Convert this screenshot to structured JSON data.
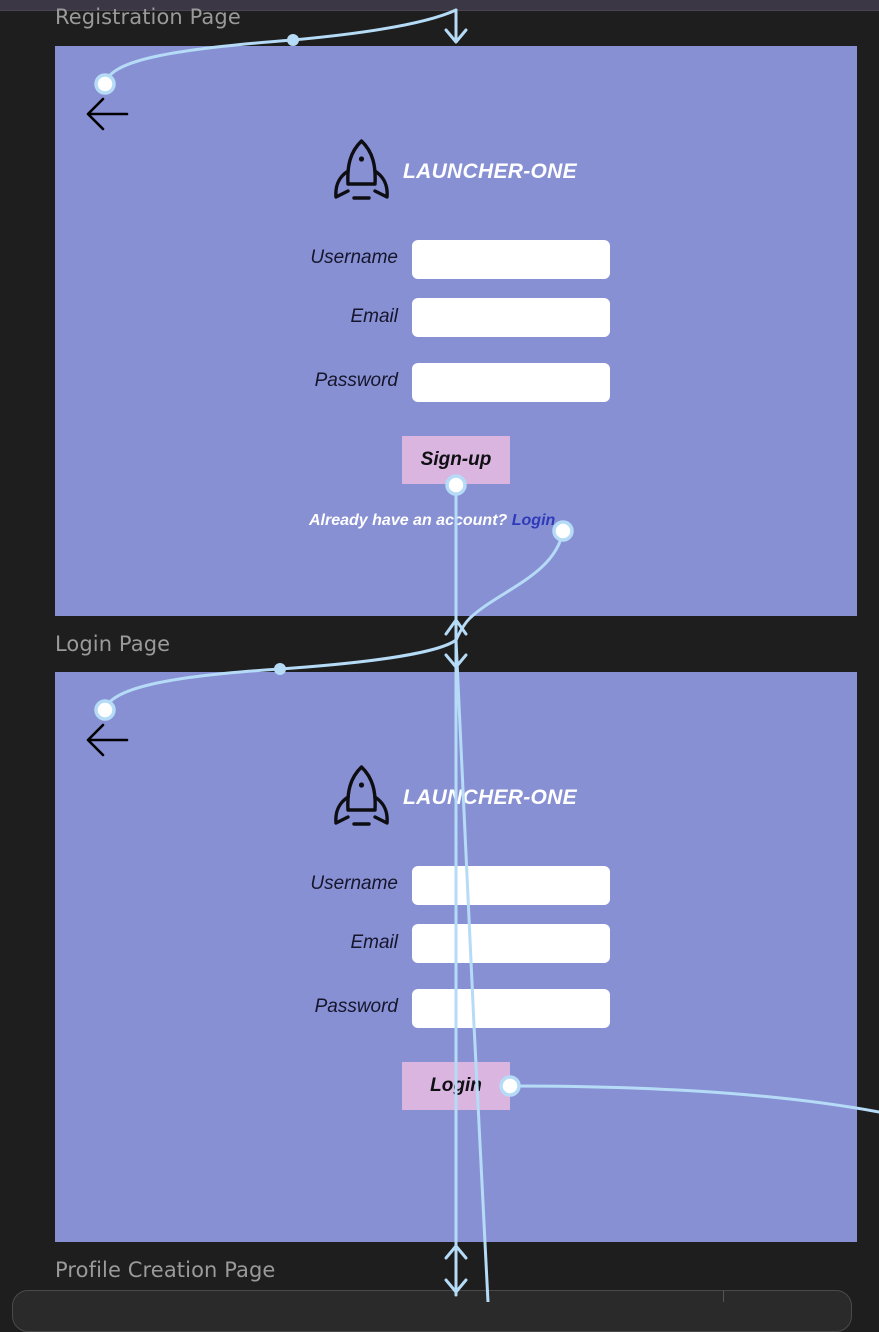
{
  "frames": {
    "registration": {
      "label": "Registration Page",
      "brand": "LAUNCHER-ONE",
      "fields": {
        "username_label": "Username",
        "email_label": "Email",
        "password_label": "Password"
      },
      "button_label": "Sign-up",
      "footer_text": "Already have an account?",
      "footer_link": "Login"
    },
    "login": {
      "label": "Login Page",
      "brand": "LAUNCHER-ONE",
      "fields": {
        "username_label": "Username",
        "email_label": "Email",
        "password_label": "Password"
      },
      "button_label": "Login"
    },
    "profile": {
      "label": "Profile Creation Page"
    }
  },
  "icons": {
    "back": "back-arrow-icon",
    "logo": "rocket-icon"
  },
  "colors": {
    "canvas": "#1e1e1e",
    "frame": "#8890d4",
    "button": "#d9b5df",
    "link": "#2f3ab8",
    "prototype_wire": "#b5dbf6"
  }
}
